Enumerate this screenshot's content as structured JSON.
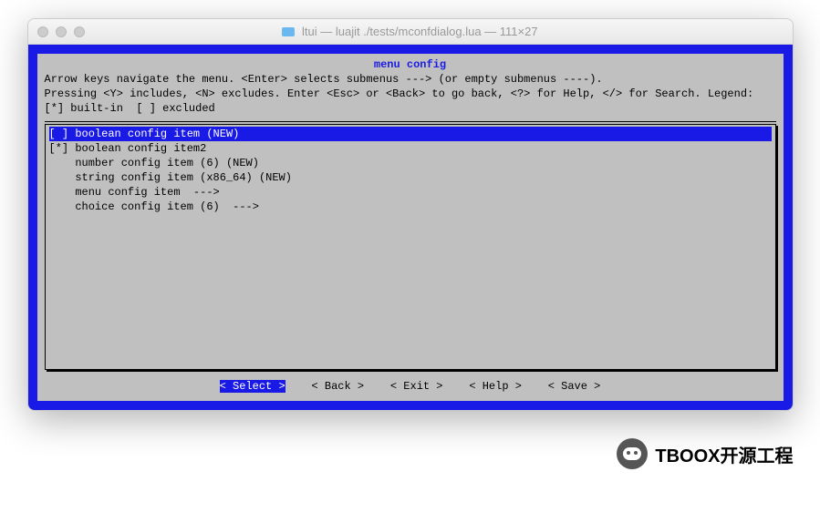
{
  "window": {
    "title": "ltui — luajit ./tests/mconfdialog.lua — 111×27"
  },
  "dialog": {
    "title": "menu config",
    "help": "Arrow keys navigate the menu. <Enter> selects submenus ---> (or empty submenus ----).\nPressing <Y> includes, <N> excludes. Enter <Esc> or <Back> to go back, <?> for Help, </> for Search. Legend: [*] built-in  [ ] excluded"
  },
  "menu": {
    "items": [
      {
        "prefix": "[ ]",
        "label": "boolean config item (NEW)",
        "selected": true
      },
      {
        "prefix": "[*]",
        "label": "boolean config item2",
        "selected": false
      },
      {
        "prefix": "   ",
        "label": "number config item (6) (NEW)",
        "selected": false
      },
      {
        "prefix": "   ",
        "label": "string config item (x86_64) (NEW)",
        "selected": false
      },
      {
        "prefix": "   ",
        "label": "menu config item  --->",
        "selected": false
      },
      {
        "prefix": "   ",
        "label": "choice config item (6)  --->",
        "selected": false
      }
    ]
  },
  "buttons": {
    "select": "< Select >",
    "back": "< Back >",
    "exit": "< Exit >",
    "help": "< Help >",
    "save": "< Save >",
    "active": "select"
  },
  "watermark": {
    "text": "TBOOX开源工程"
  }
}
